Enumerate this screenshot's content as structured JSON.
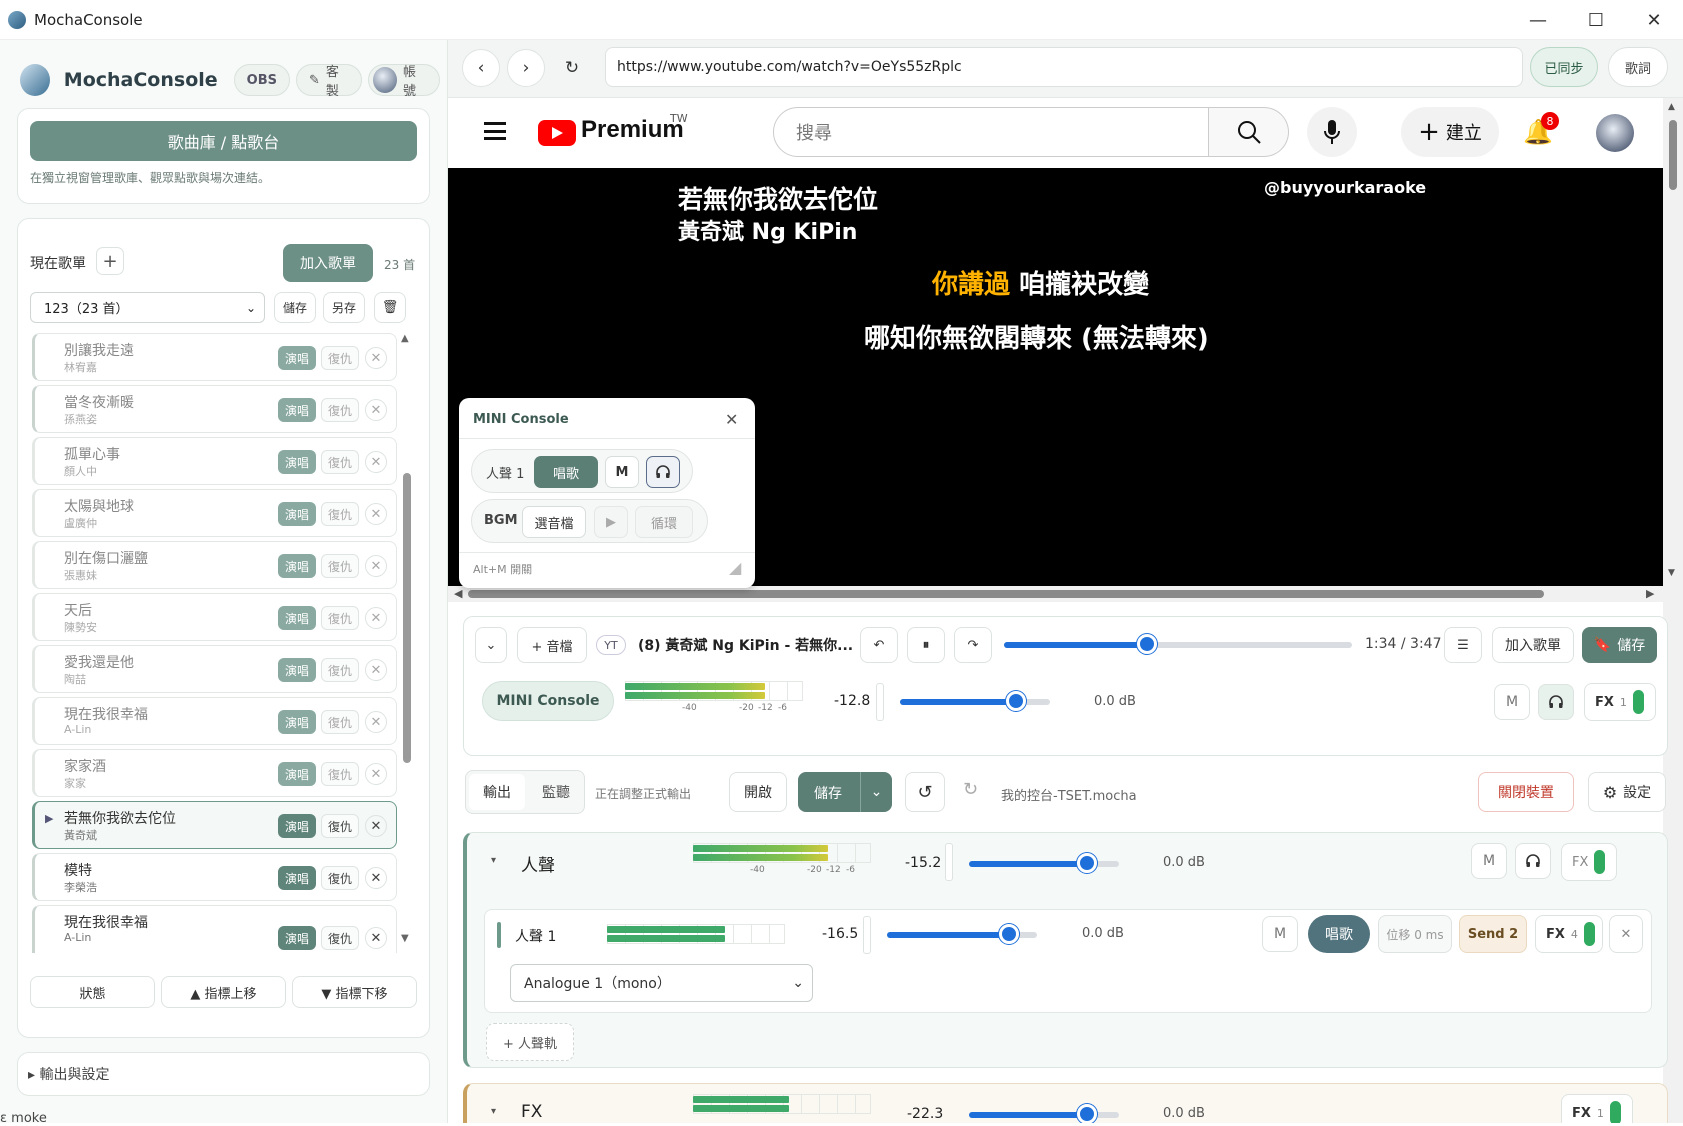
{
  "window": {
    "title": "MochaConsole",
    "controls": [
      "—",
      "☐",
      "✕"
    ]
  },
  "left": {
    "brand": "MochaConsole",
    "obs": "OBS",
    "customize": "客製",
    "account": "帳號",
    "library_button": "歌曲庫 / 點歌台",
    "library_caption": "在獨立視窗管理歌庫、觀眾點歌與場次連結。",
    "setlist_label": "現在歌單",
    "add_button": "加入歌單",
    "count": "23 首",
    "playlist_select": "123（23 首）",
    "save": "儲存",
    "save_as": "另存",
    "songs": [
      {
        "title": "別讓我走遠",
        "artist": "林宥嘉",
        "sing": "演唱",
        "reset": "復仇"
      },
      {
        "title": "當冬夜漸暖",
        "artist": "孫燕姿",
        "sing": "演唱",
        "reset": "復仇"
      },
      {
        "title": "孤單心事",
        "artist": "顏人中",
        "sing": "演唱",
        "reset": "復仇"
      },
      {
        "title": "太陽與地球",
        "artist": "盧廣仲",
        "sing": "演唱",
        "reset": "復仇"
      },
      {
        "title": "別在傷口灑鹽",
        "artist": "張惠妹",
        "sing": "演唱",
        "reset": "復仇"
      },
      {
        "title": "天后",
        "artist": "陳勢安",
        "sing": "演唱",
        "reset": "復仇"
      },
      {
        "title": "愛我還是他",
        "artist": "陶喆",
        "sing": "演唱",
        "reset": "復仇"
      },
      {
        "title": "現在我很幸福",
        "artist": "A-Lin",
        "sing": "演唱",
        "reset": "復仇"
      },
      {
        "title": "家家酒",
        "artist": "家家",
        "sing": "演唱",
        "reset": "復仇"
      },
      {
        "title": "若無你我欲去佗位",
        "artist": "黃奇斌",
        "sing": "演唱",
        "reset": "復仇"
      },
      {
        "title": "模特",
        "artist": "李榮浩",
        "sing": "演唱",
        "reset": "復仇"
      },
      {
        "title": "現在我很幸福",
        "artist": "A-Lin",
        "sing": "演唱",
        "reset": "復仇"
      }
    ],
    "status_btn": "狀態",
    "up_btn": "▲ 指標上移",
    "down_btn": "▼ 指標下移",
    "output_settings": "▸ 輸出與設定",
    "cut_text": "ɛ moke"
  },
  "browser": {
    "url": "https://www.youtube.com/watch?v=OeYs55zRplc",
    "synced": "已同步",
    "lyrics": "歌詞",
    "yt_premium": "Premium",
    "yt_region": "TW",
    "yt_search_placeholder": "搜尋",
    "yt_create": "建立",
    "yt_notifications": "8"
  },
  "video": {
    "title_line1": "若無你我欲去佗位",
    "title_line2": "黃奇斌 Ng KiPin",
    "watermark": "@buyyourkaraoke",
    "lyric1_highlight": "你講過",
    "lyric1_rest": " 咱攏袂改變",
    "lyric2": "哪知你無欲閣轉來 (無法轉來)"
  },
  "mini_console": {
    "title": "MINI Console",
    "ch_label": "人聲 1",
    "sing": "唱歌",
    "mute": "M",
    "bgm_label": "BGM",
    "select_file": "選音檔",
    "loop": "循環",
    "shortcut": "Alt+M 開關"
  },
  "player": {
    "audio_btn": "+ 音檔",
    "source_tag": "YT",
    "now_playing": "(8) 黃奇斌 Ng KiPin - 若無你...",
    "time": "1:34 / 3:47",
    "progress": 0.41,
    "add_to_list": "加入歌單",
    "save": "儲存",
    "mini_console": "MINI Console",
    "level": "-12.8",
    "gain": "0.0  dB",
    "mute": "M",
    "fx": "FX",
    "fx_count": "1"
  },
  "meter_ticks": [
    "-40",
    "-20",
    "-12",
    "-6"
  ],
  "output_bar": {
    "tab_output": "輸出",
    "tab_monitor": "監聽",
    "status": "正在調整正式輸出",
    "open": "開啟",
    "save": "儲存",
    "config_name": "我的控台-TSET.mocha",
    "close_device": "關閉裝置",
    "settings": "設定"
  },
  "vocal_section": {
    "name": "人聲",
    "level": "-15.2",
    "gain": "0.0  dB",
    "mute": "M",
    "fx": "FX",
    "channel": {
      "name": "人聲 1",
      "level": "-16.5",
      "gain": "0.0  dB",
      "mute": "M",
      "sing": "唱歌",
      "offset": "位移 0 ms",
      "send": "Send 2",
      "fx": "FX",
      "fx_count": "4",
      "input": "Analogue 1（mono）"
    },
    "add_track": "+ 人聲軌"
  },
  "fx_section": {
    "name": "FX",
    "level": "-22.3",
    "gain": "0.0  dB",
    "fx": "FX",
    "fx_count": "1"
  }
}
